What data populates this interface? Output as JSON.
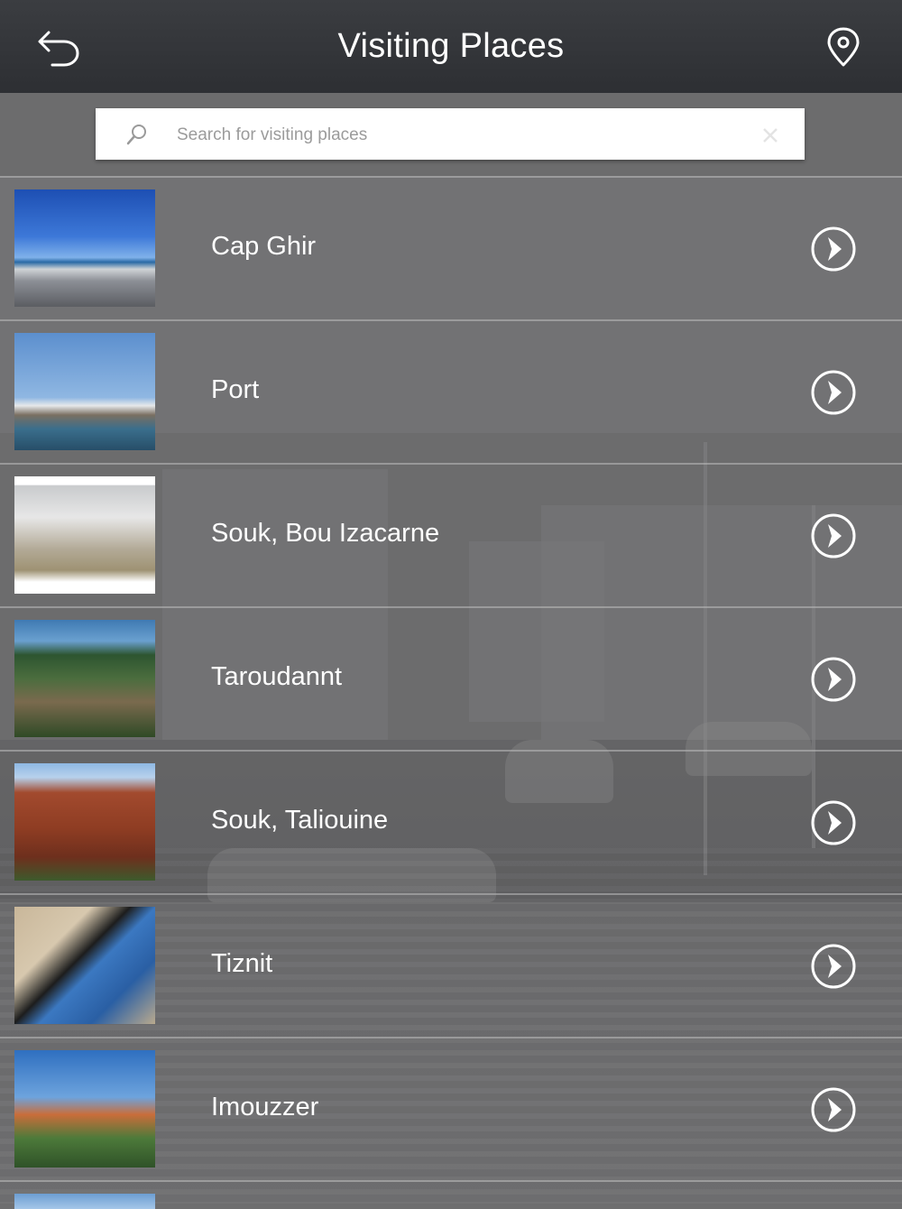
{
  "header": {
    "title": "Visiting Places",
    "back_icon": "back-arrow-icon",
    "location_icon": "location-pin-icon"
  },
  "search": {
    "placeholder": "Search for visiting places",
    "value": ""
  },
  "places": [
    {
      "name": "Cap Ghir",
      "image": "coastal-city-photo"
    },
    {
      "name": "Port",
      "image": "harbor-boats-photo"
    },
    {
      "name": "Souk, Bou Izacarne",
      "image": "roadside-sign-photo"
    },
    {
      "name": "Taroudannt",
      "image": "green-valley-photo"
    },
    {
      "name": "Souk, Taliouine",
      "image": "red-kasbah-photo"
    },
    {
      "name": "Tiznit",
      "image": "blue-door-palm-photo"
    },
    {
      "name": "Imouzzer",
      "image": "orange-building-photo"
    }
  ],
  "colors": {
    "header_bg": "#2f3135",
    "text": "#ffffff",
    "search_bg": "#ffffff",
    "placeholder": "#9b9b9b"
  }
}
